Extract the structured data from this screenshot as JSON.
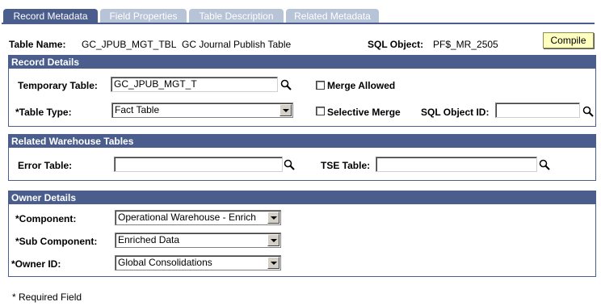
{
  "tabs": [
    {
      "label": "Record Metadata",
      "active": true
    },
    {
      "label": "Field Properties",
      "active": false
    },
    {
      "label": "Table Description",
      "active": false
    },
    {
      "label": "Related Metadata",
      "active": false
    }
  ],
  "header": {
    "table_name_label": "Table Name:",
    "table_name_value": "GC_JPUB_MGT_TBL",
    "table_desc": "GC Journal Publish Table",
    "sql_object_label": "SQL Object:",
    "sql_object_value": "PF$_MR_2505",
    "compile_label": "Compile"
  },
  "record_details": {
    "title": "Record Details",
    "temp_table_label": "Temporary Table:",
    "temp_table_value": "GC_JPUB_MGT_T",
    "merge_allowed_label": "Merge Allowed",
    "table_type_label": "*Table Type:",
    "table_type_value": "Fact Table",
    "selective_merge_label": "Selective Merge",
    "sql_object_id_label": "SQL Object ID:",
    "sql_object_id_value": ""
  },
  "related_tables": {
    "title": "Related Warehouse Tables",
    "error_table_label": "Error Table:",
    "error_table_value": "",
    "tse_table_label": "TSE Table:",
    "tse_table_value": ""
  },
  "owner_details": {
    "title": "Owner Details",
    "component_label": "*Component:",
    "component_value": "Operational Warehouse - Enrich",
    "sub_component_label": "*Sub Component:",
    "sub_component_value": "Enriched Data",
    "owner_id_label": "*Owner ID:",
    "owner_id_value": "Global Consolidations"
  },
  "footer": {
    "required_note": "* Required Field"
  },
  "colors": {
    "accent": "#4a5d8c",
    "tab_inactive": "#b7c3d6",
    "compile_bg": "#ffffc0"
  },
  "icons": {
    "lookup": "magnifier-icon",
    "dropdown": "chevron-down-icon",
    "checkbox": "checkbox-icon"
  }
}
